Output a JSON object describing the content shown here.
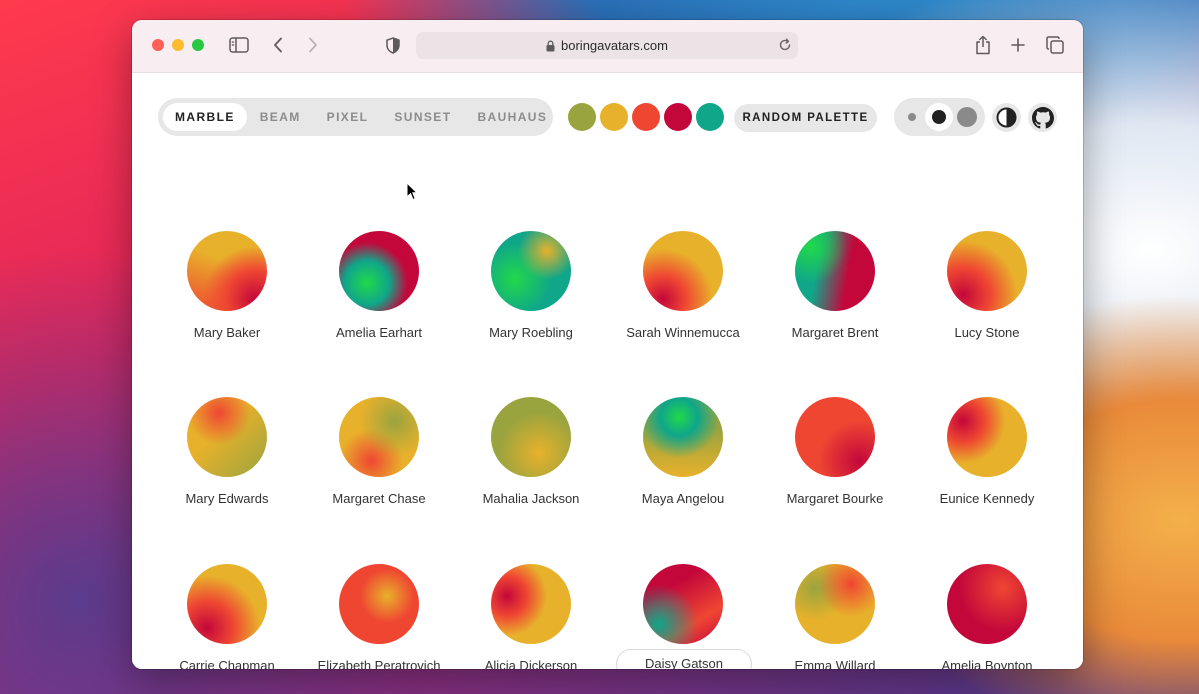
{
  "browser": {
    "url": "boringavatars.com"
  },
  "toolbar": {
    "variants": [
      "MARBLE",
      "BEAM",
      "PIXEL",
      "SUNSET",
      "BAUHAUS"
    ],
    "active_variant": "MARBLE",
    "palette": [
      "#9aa43f",
      "#e8b12b",
      "#ef4632",
      "#c3073b",
      "#0fa68a"
    ],
    "random_label": "RANDOM PALETTE",
    "size_options": [
      "small",
      "medium",
      "large"
    ],
    "selected_size": "medium"
  },
  "avatars": [
    {
      "name": "Mary Baker"
    },
    {
      "name": "Amelia Earhart"
    },
    {
      "name": "Mary Roebling"
    },
    {
      "name": "Sarah Winnemucca"
    },
    {
      "name": "Margaret Brent"
    },
    {
      "name": "Lucy Stone"
    },
    {
      "name": "Mary Edwards"
    },
    {
      "name": "Margaret Chase"
    },
    {
      "name": "Mahalia Jackson"
    },
    {
      "name": "Maya Angelou"
    },
    {
      "name": "Margaret Bourke"
    },
    {
      "name": "Eunice Kennedy"
    },
    {
      "name": "Carrie Chapman"
    },
    {
      "name": "Elizabeth Peratrovich"
    },
    {
      "name": "Alicia Dickerson"
    },
    {
      "name": "Daisy Gatson"
    },
    {
      "name": "Emma Willard"
    },
    {
      "name": "Amelia Boynton"
    }
  ]
}
